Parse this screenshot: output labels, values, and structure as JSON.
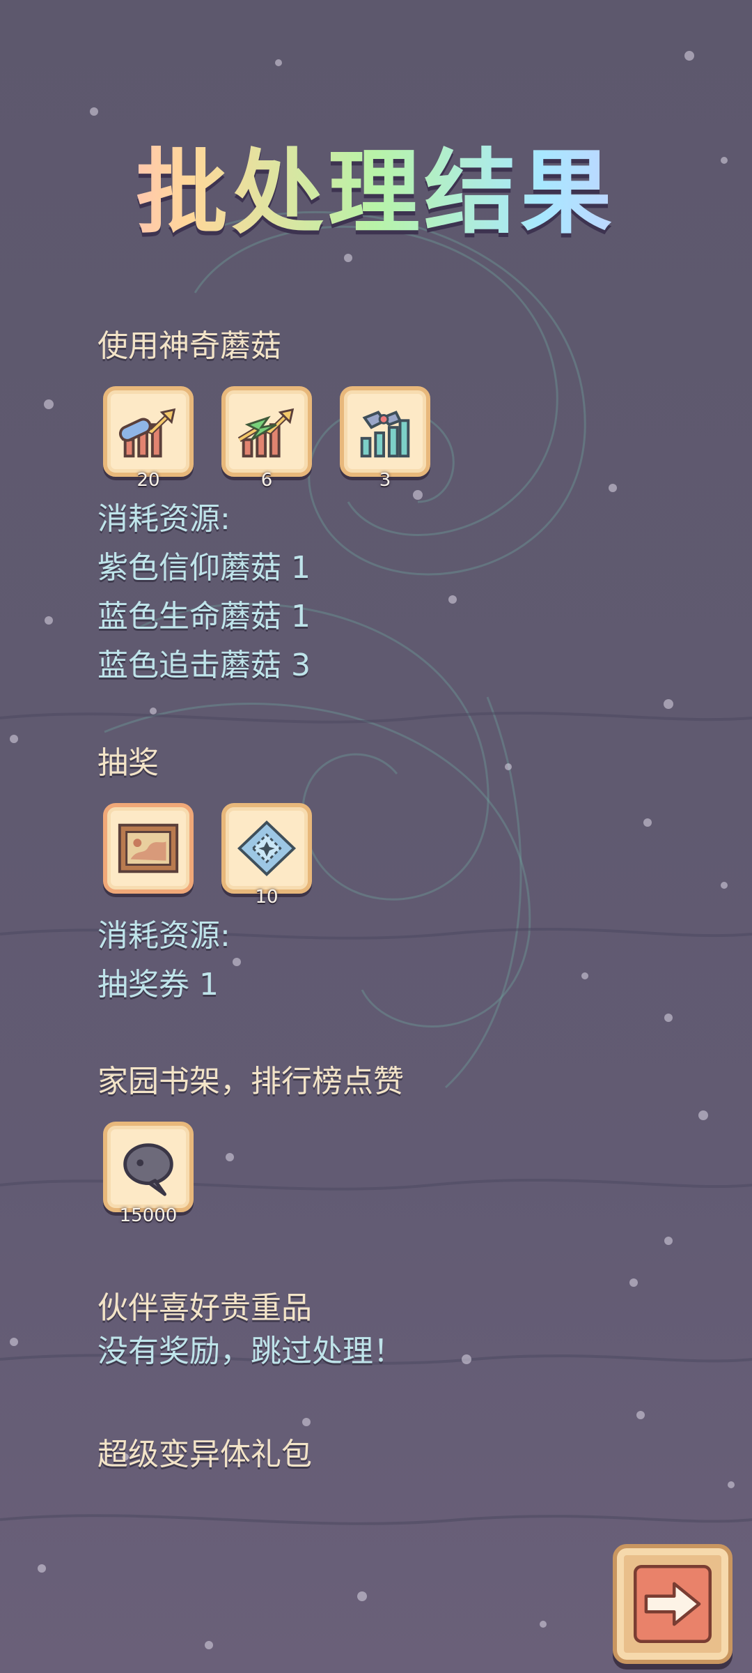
{
  "title": "批处理结果",
  "sections": [
    {
      "heading": "使用神奇蘑菇",
      "items": [
        {
          "icon": "faith-boost-icon",
          "count": "20"
        },
        {
          "icon": "life-boost-icon",
          "count": "6"
        },
        {
          "icon": "chase-boost-icon",
          "count": "3"
        }
      ],
      "consumed_label": "消耗资源:",
      "consumed": [
        "紫色信仰蘑菇 1",
        "蓝色生命蘑菇 1",
        "蓝色追击蘑菇 3"
      ]
    },
    {
      "heading": "抽奖",
      "items": [
        {
          "icon": "painting-icon",
          "count": ""
        },
        {
          "icon": "ticket-icon",
          "count": "10"
        }
      ],
      "consumed_label": "消耗资源:",
      "consumed": [
        "抽奖券 1"
      ]
    },
    {
      "heading": "家园书架，排行榜点赞",
      "items": [
        {
          "icon": "speech-bubble-icon",
          "count": "15000"
        }
      ]
    },
    {
      "heading": "伙伴喜好贵重品",
      "note": "没有奖励，跳过处理！"
    },
    {
      "heading": "超级变异体礼包"
    }
  ],
  "next_button": {
    "icon": "arrow-right-icon"
  }
}
